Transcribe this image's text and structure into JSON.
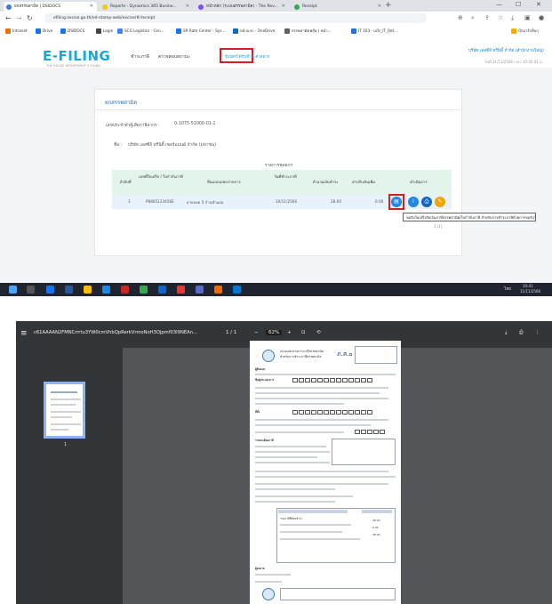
{
  "browser": {
    "tabs": [
      {
        "label": "ยกสรรพสามิต | DSIDOCS"
      },
      {
        "label": "Reports - Dynamics 365 Busine..."
      },
      {
        "label": "หน้าหลัก (ระบบสรรพสามิต) - The Rev..."
      },
      {
        "label": "Receipt"
      }
    ],
    "url": "efiling.excise.go.th/ed-stamp-web/excise/#/receipt",
    "bookmarks": [
      {
        "label": "Intranet"
      },
      {
        "label": "Drive"
      },
      {
        "label": "DSIDOCS"
      },
      {
        "label": "Login"
      },
      {
        "label": "SCG Logistics - Cen..."
      },
      {
        "label": "SR Rate Center - Sys..."
      },
      {
        "label": "หน้าแรก - OneDrive"
      },
      {
        "label": "สรรพสามิตฟลุ๊ค | หน้า..."
      },
      {
        "label": "IT 103 - แบ๊ก_IT_Ret..."
      },
      {
        "label": "บุ๊กมาร์กอื่นๆ"
      }
    ],
    "window_controls": {
      "minimize": "—",
      "maximize": "☐",
      "close": "✕",
      "new_tab": "+"
    },
    "site": {
      "logo": "E-FILING",
      "logo_sub": "THE EXCISE DEPARTMENT E-FILING",
      "nav": [
        "ชำระภาษี",
        "ตรวจสอบสถานะ",
        "รับบัตรได้รับชำระค่าสลาก"
      ],
      "user_name": "บริษัท เอสซีจี ทรีนิตี้ จำกัด (สำนักงานใหญ่)",
      "user_meta": "วันที่ 11/11/2566 เวลา 10:30:41 น."
    },
    "receipt_section": {
      "title": "ยกสรรพสามิต",
      "tax_id_label": "เลขประจำตัวผู้เสียภาษีอากร :",
      "tax_id_value": "0-1075-51000-01-1",
      "company_label": "ชื่อ :",
      "company_value": "บริษัท เอสซีจี ทรีนิตี้ เซอร์แมนด์ จำกัด (มหาชน)",
      "list_label": "รายการชุดยกร",
      "columns": [
        "ลำดับที่",
        "เลขที่ใบเสร็จ / ใบกำกับภาษี",
        "ยื่นแบบแสดงรายการ",
        "วันที่ชำระภาษี",
        "จำนวนเงินชำระ",
        "ค่าปรับเงินเพิ่ม",
        "ดำเนินการ"
      ],
      "rows": [
        {
          "no": "1",
          "receipt_no": "P8865123456E",
          "description": "ยาหลอด 5 ก้านชำแผล",
          "date": "10/11/2566",
          "amount": "28.00",
          "fine": "0.00"
        }
      ],
      "action_icons": [
        "document-icon",
        "info-icon",
        "print-icon",
        "edit-icon"
      ],
      "tooltip": "ขอรับใบเสร็จรับเงินภาษีสรรพสามิต/ใบกำกับภาษี สำหรับการชำระภาษีด้วยการขอรับใบเสร็จ",
      "pagination": "1 |1|"
    },
    "taskbar": {
      "time": "10:41",
      "date": "11/11/2566",
      "lang": "ไทย"
    }
  },
  "pdf_viewer": {
    "title": "c61AAAAN2FMNCrrrtu3YW0cmVhbQpRerkVrmoNoH3Ojpmf03I9NEAn...",
    "page_indicator": "1 / 1",
    "zoom": "62%",
    "thumbnail_page": "1",
    "document": {
      "header_line1": "แบบแสดงรายการภาษีสรรพสามิต",
      "header_line2": "สำหรับการชำระภาษีสรรพสามิต",
      "form_code": "ภ.ส.๐",
      "section_labels": [
        "ผู้ยื่นแบบ",
        "ชื่อผู้ประกอบการ",
        "ที่ตั้ง",
        "รายละเอียดภาษี",
        "รวมภาษีที่ต้องชำระ",
        "ผู้ลงนาม"
      ],
      "totals": [
        "28.00",
        "0.00",
        "28.00"
      ]
    }
  }
}
